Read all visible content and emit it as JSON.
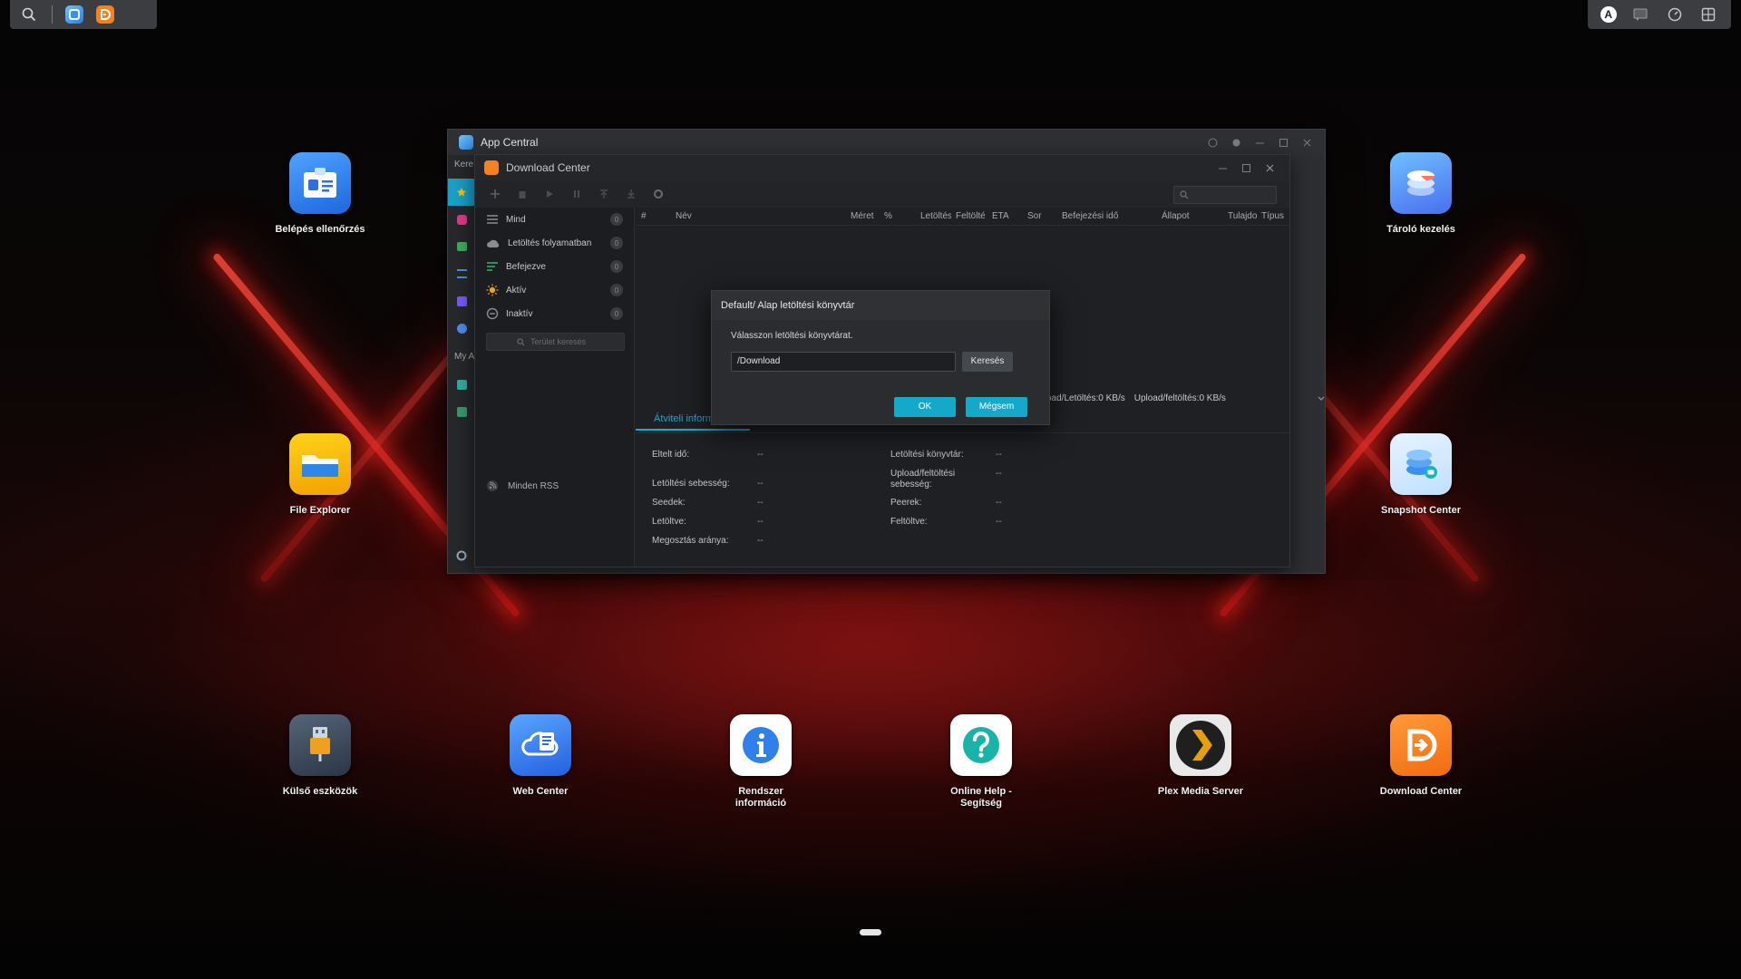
{
  "taskbar": {
    "search_icon": "search-icon",
    "apps": [
      "App Central",
      "Download Center"
    ],
    "user_initial": "A"
  },
  "desktop": {
    "icons": [
      {
        "label": "Belépés ellenőrzés",
        "icon": "id-card-icon",
        "color": "#2f7ef0"
      },
      {
        "label": "Tároló kezelés",
        "icon": "storage-stack-icon",
        "color": "#3a8cf5"
      },
      {
        "label": "File Explorer",
        "icon": "folder-icon",
        "color": "#f5b800"
      },
      {
        "label": "Snapshot Center",
        "icon": "snapshot-icon",
        "color": "#4aa8f0"
      },
      {
        "label": "Külső eszközök",
        "icon": "usb-icon",
        "color": "#3a4a5e"
      },
      {
        "label": "Web Center",
        "icon": "web-cloud-icon",
        "color": "#3a7ef0"
      },
      {
        "label": "Rendszer",
        "label2": "információ",
        "icon": "info-icon",
        "color": "#ffffff"
      },
      {
        "label": "Online Help -",
        "label2": "Segítség",
        "icon": "help-icon",
        "color": "#ffffff"
      },
      {
        "label": "Plex Media Server",
        "icon": "plex-icon",
        "color": "#2a2a2a"
      },
      {
        "label": "Download Center",
        "icon": "download-center-icon",
        "color": "#f58220"
      }
    ]
  },
  "app_central": {
    "title": "App Central",
    "side_search_text": "Kere",
    "my_apps_text": "My A"
  },
  "download_center": {
    "title": "Download Center",
    "filters": [
      {
        "label": "Mind",
        "count": "0"
      },
      {
        "label": "Letöltés folyamatban",
        "count": "0"
      },
      {
        "label": "Befejezve",
        "count": "0"
      },
      {
        "label": "Aktív",
        "count": "0"
      },
      {
        "label": "Inaktív",
        "count": "0"
      }
    ],
    "tag_search_placeholder": "Terület keresés",
    "rss_label": "Minden RSS",
    "columns": {
      "hash": "#",
      "name": "Név",
      "size": "Méret",
      "percent": "%",
      "download": "Letöltés",
      "upload": "Feltöltés",
      "eta": "ETA",
      "queue": "Sor",
      "completed_time": "Befejezési idő",
      "status": "Állapot",
      "owner": "Tulajdo",
      "type": "Típus"
    },
    "speed": {
      "download": "oad/Letöltés:0 KB/s",
      "upload": "Upload/feltöltés:0 KB/s"
    },
    "tab_label": "Átviteli információk",
    "info_left": [
      {
        "label": "Eltelt idő:",
        "value": "--"
      },
      {
        "label": "Letöltési sebesség:",
        "value": "--"
      },
      {
        "label": "Seedek:",
        "value": "--"
      },
      {
        "label": "Letöltve:",
        "value": "--"
      },
      {
        "label": "Megosztás aránya:",
        "value": "--"
      }
    ],
    "info_right": [
      {
        "label": "Letöltési könyvtár:",
        "value": "--"
      },
      {
        "label": "Upload/feltöltési",
        "label2": "sebesség:",
        "value": "--"
      },
      {
        "label": "Peerek:",
        "value": "--"
      },
      {
        "label": "Feltöltve:",
        "value": "--"
      }
    ]
  },
  "dialog": {
    "title": "Default/ Alap letöltési könyvtár",
    "message": "Válasszon letöltési könyvtárat.",
    "path_value": "/Download",
    "browse_label": "Keresés",
    "ok_label": "OK",
    "cancel_label": "Mégsem"
  },
  "colors": {
    "accent": "#14a9c9",
    "window_bg": "#1f2023",
    "dialog_bg": "#2a2c30"
  }
}
